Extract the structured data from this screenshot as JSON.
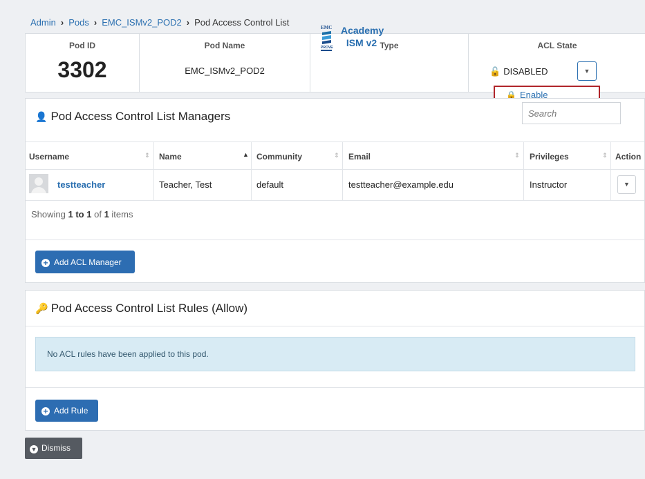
{
  "breadcrumb": {
    "items": [
      "Admin",
      "Pods",
      "EMC_ISMv2_POD2"
    ],
    "current": "Pod Access Control List"
  },
  "pod": {
    "headers": {
      "id": "Pod ID",
      "name": "Pod Name",
      "type": "Type",
      "acl_state": "ACL State"
    },
    "id": "3302",
    "name": "EMC_ISMv2_POD2",
    "type_line1": "Academy",
    "type_line2": "ISM v2",
    "acl_state": "DISABLED"
  },
  "acl_menu": {
    "enable_label": "Enable"
  },
  "managers": {
    "title": "Pod Access Control List Managers",
    "search_placeholder": "Search",
    "columns": {
      "username": "Username",
      "name": "Name",
      "community": "Community",
      "email": "Email",
      "privileges": "Privileges",
      "action": "Action"
    },
    "rows": [
      {
        "username": "testteacher",
        "name": "Teacher, Test",
        "community": "default",
        "email": "testteacher@example.edu",
        "privileges": "Instructor"
      }
    ],
    "showing_prefix": "Showing",
    "showing_range": "1 to 1",
    "showing_of": "of",
    "showing_total": "1",
    "showing_suffix": "items",
    "add_button": "Add ACL Manager"
  },
  "rules": {
    "title": "Pod Access Control List Rules (Allow)",
    "empty_message": "No ACL rules have been applied to this pod.",
    "add_button": "Add Rule"
  },
  "dismiss_label": "Dismiss",
  "colors": {
    "link": "#2a6fb0",
    "primary_button": "#2d6db2",
    "dismiss_button": "#555a61",
    "alert_bg": "#d8ebf4",
    "menu_highlight_border": "#b0252a",
    "lock_open": "#b22222",
    "lock_closed": "#2e9b4a"
  }
}
